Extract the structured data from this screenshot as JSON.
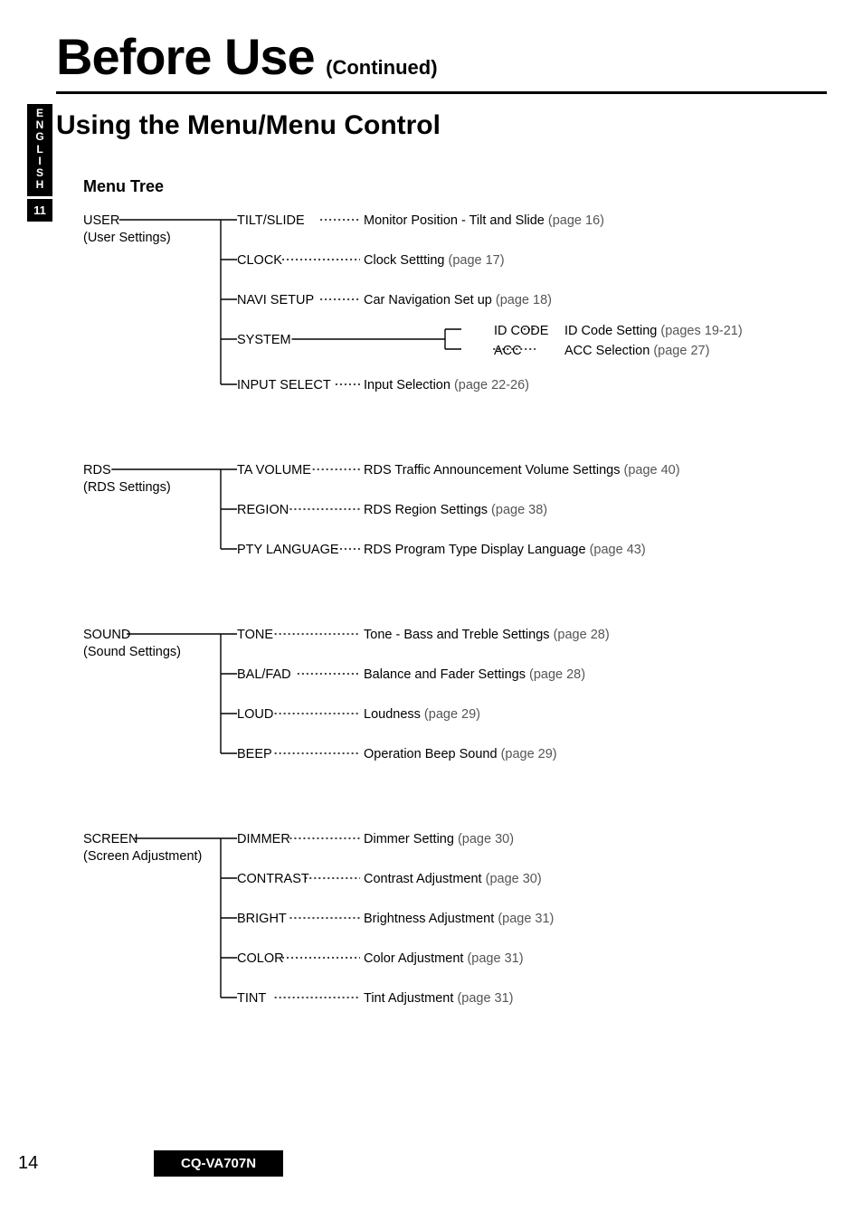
{
  "side": {
    "lang": [
      "E",
      "N",
      "G",
      "L",
      "I",
      "S",
      "H"
    ],
    "num": "11"
  },
  "header": {
    "title": "Before Use",
    "continued": "(Continued)"
  },
  "subtitle": "Using the Menu/Menu Control",
  "section": "Menu Tree",
  "groups": [
    {
      "root": "USER",
      "rootSub": "(User Settings)",
      "items": [
        {
          "menu": "TILT/SLIDE",
          "desc": "Monitor Position - Tilt and Slide",
          "page": "(page 16)"
        },
        {
          "menu": "CLOCK",
          "desc": "Clock Settting",
          "page": "(page 17)"
        },
        {
          "menu": "NAVI SETUP",
          "desc": "Car Navigation Set up",
          "page": "(page 18)"
        },
        {
          "menu": "SYSTEM",
          "sub": [
            {
              "menu": "ID CODE",
              "desc": "ID Code Setting",
              "page": "(pages 19-21)"
            },
            {
              "menu": "ACC",
              "desc": "ACC Selection",
              "page": "(page 27)"
            }
          ]
        },
        {
          "menu": "INPUT SELECT",
          "desc": "Input Selection",
          "page": "(page 22-26)"
        }
      ]
    },
    {
      "root": "RDS",
      "rootSub": "(RDS Settings)",
      "items": [
        {
          "menu": "TA VOLUME",
          "desc": "RDS Traffic Announcement Volume Settings",
          "page": "(page 40)"
        },
        {
          "menu": "REGION",
          "desc": "RDS Region Settings",
          "page": "(page 38)"
        },
        {
          "menu": "PTY LANGUAGE",
          "desc": "RDS Program Type Display Language",
          "page": "(page 43)"
        }
      ]
    },
    {
      "root": "SOUND",
      "rootSub": "(Sound Settings)",
      "items": [
        {
          "menu": "TONE",
          "desc": "Tone - Bass and Treble Settings",
          "page": "(page 28)"
        },
        {
          "menu": "BAL/FAD",
          "desc": "Balance and Fader Settings",
          "page": "(page 28)"
        },
        {
          "menu": "LOUD",
          "desc": "Loudness",
          "page": "(page 29)"
        },
        {
          "menu": "BEEP",
          "desc": "Operation Beep Sound",
          "page": "(page 29)"
        }
      ]
    },
    {
      "root": "SCREEN",
      "rootSub": "(Screen Adjustment)",
      "items": [
        {
          "menu": "DIMMER",
          "desc": "Dimmer Setting",
          "page": "(page 30)"
        },
        {
          "menu": "CONTRAST",
          "desc": "Contrast Adjustment",
          "page": "(page 30)"
        },
        {
          "menu": "BRIGHT",
          "desc": "Brightness Adjustment",
          "page": "(page 31)"
        },
        {
          "menu": "COLOR",
          "desc": "Color Adjustment",
          "page": "(page 31)"
        },
        {
          "menu": "TINT",
          "desc": "Tint Adjustment",
          "page": "(page 31)"
        }
      ]
    }
  ],
  "footer": {
    "pageNum": "14",
    "model": "CQ-VA707N"
  }
}
